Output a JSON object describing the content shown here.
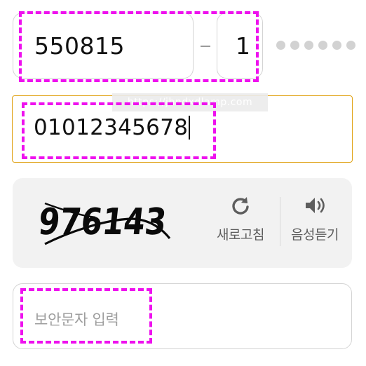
{
  "id_field": {
    "front": "550815",
    "back_first_digit": "1",
    "masked_digit_count": 6
  },
  "phone_field": {
    "value": "01012345678"
  },
  "watermark": "https://jhndxdlamp.com",
  "captcha": {
    "code": "976143",
    "refresh_label": "새로고침",
    "audio_label": "음성듣기"
  },
  "security_input": {
    "placeholder": "보안문자 입력"
  },
  "colors": {
    "focus_border": "#e0a214",
    "annotation": "#ee11ee",
    "panel_bg": "#f2f2f2"
  }
}
